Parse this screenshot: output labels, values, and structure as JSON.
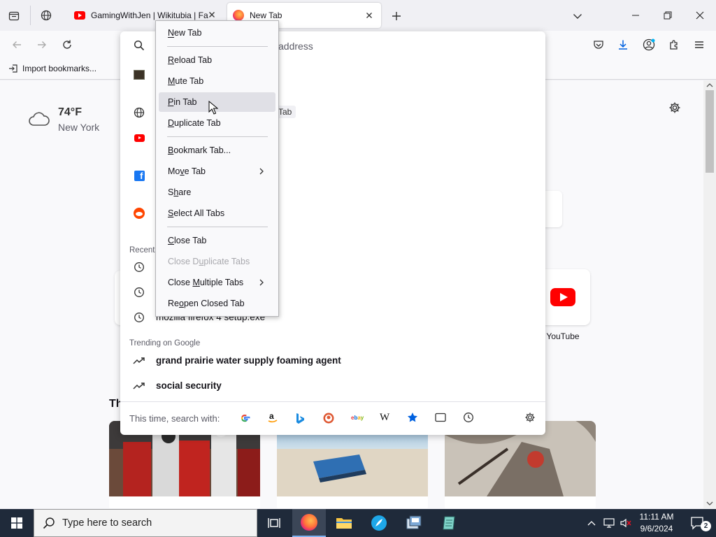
{
  "tabs": [
    {
      "title": "GamingWithJen | Wikitubia | Fa",
      "favicon": "youtube-icon"
    },
    {
      "title": "New Tab",
      "favicon": "firefox-icon"
    }
  ],
  "nav": {
    "url_placeholder": "address",
    "bookmarks_import": "Import bookmarks..."
  },
  "weather": {
    "temp": "74°F",
    "city": "New York"
  },
  "shortcuts": {
    "youtube_label": "YouTube",
    "tab_badge": "Tab"
  },
  "section_heading": "Th",
  "urlbar_panel": {
    "recent_heading": "Recent",
    "recent_items": [
      "",
      "",
      "mozilla firefox 4 setup.exe"
    ],
    "trending_heading": "Trending on Google",
    "trending_items": [
      "grand prairie water supply foaming agent",
      "social security"
    ],
    "search_with_label": "This time, search with:"
  },
  "context_menu": {
    "items": [
      {
        "label": "New Tab",
        "accel": "N"
      },
      {
        "label": "Reload Tab",
        "accel": "R"
      },
      {
        "label": "Mute Tab",
        "accel": "M"
      },
      {
        "label": "Pin Tab",
        "accel": "P"
      },
      {
        "label": "Duplicate Tab",
        "accel": "D"
      },
      {
        "label": "Bookmark Tab...",
        "accel": "B"
      },
      {
        "label": "Move Tab",
        "accel": "v"
      },
      {
        "label": "Share",
        "accel": "h"
      },
      {
        "label": "Select All Tabs",
        "accel": "S"
      },
      {
        "label": "Close Tab",
        "accel": "C"
      },
      {
        "label": "Close Duplicate Tabs",
        "accel": "u"
      },
      {
        "label": "Close Multiple Tabs",
        "accel": "M"
      },
      {
        "label": "Reopen Closed Tab",
        "accel": "o"
      }
    ]
  },
  "taskbar": {
    "search_placeholder": "Type here to search",
    "time": "11:11 AM",
    "date": "9/6/2024",
    "notification_count": "2"
  },
  "colors": {
    "accent": "#0061e0",
    "youtube": "#ff0000",
    "facebook": "#1877f2",
    "reddit": "#ff4500",
    "taskbar": "#1f2a3a"
  }
}
